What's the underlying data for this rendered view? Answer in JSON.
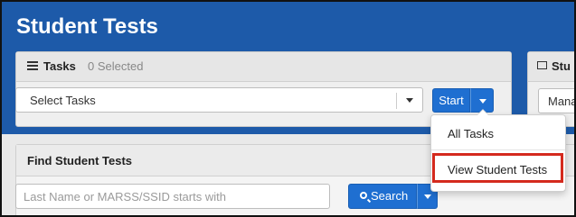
{
  "page": {
    "title": "Student Tests"
  },
  "tasks": {
    "title": "Tasks",
    "selected_count": "0 Selected",
    "select_placeholder": "Select Tasks",
    "start_label": "Start"
  },
  "dropdown": {
    "items": [
      {
        "label": "All Tasks"
      },
      {
        "label": "View Student Tests"
      }
    ]
  },
  "panel2": {
    "title": "Stu",
    "select_text": "Mana"
  },
  "find": {
    "title": "Find Student Tests",
    "search_placeholder": "Last Name or MARSS/SSID starts with",
    "search_label": "Search"
  },
  "colors": {
    "header": "#1d5aa9",
    "primary_button": "#1f6fd1",
    "highlight": "#d42a1e"
  }
}
